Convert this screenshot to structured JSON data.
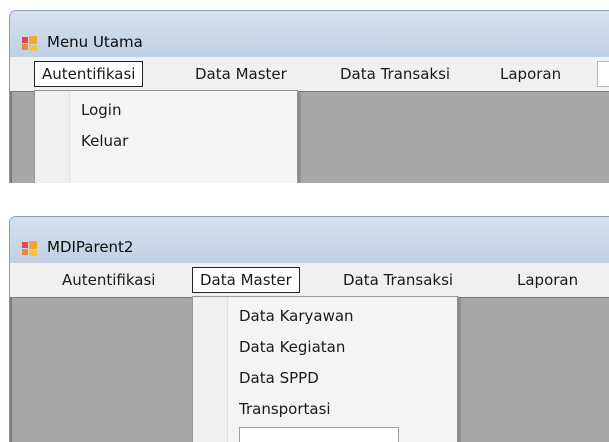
{
  "window1": {
    "title": "Menu Utama",
    "menu": [
      "Autentifikasi",
      "Data Master",
      "Data Transaksi",
      "Laporan"
    ],
    "active_menu": "Autentifikasi",
    "dropdown": [
      "Login",
      "Keluar"
    ]
  },
  "window2": {
    "title": "MDIParent2",
    "menu": [
      "Autentifikasi",
      "Data Master",
      "Data Transaksi",
      "Laporan"
    ],
    "active_menu": "Data Master",
    "dropdown": [
      "Data Karyawan",
      "Data Kegiatan",
      "Data SPPD",
      "Transportasi"
    ]
  },
  "icons": {
    "app_icon": "windows-form-icon"
  },
  "colors": {
    "titlebar": "#c6d5e6",
    "menubar": "#f0f0f0",
    "mdi_client": "#a8a8a8",
    "dropdown_bg": "#f4f4f4"
  }
}
